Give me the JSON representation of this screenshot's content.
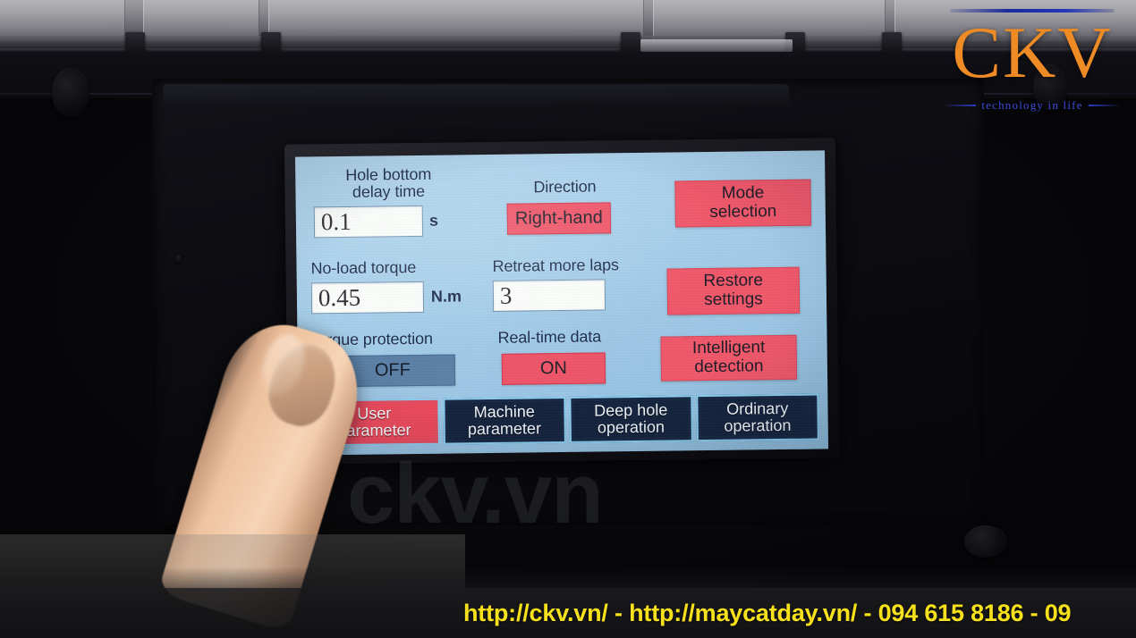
{
  "logo": {
    "name": "CKV",
    "tagline": "technology in life",
    "color": "#ef8b24",
    "tagline_color": "#3b4bd4"
  },
  "watermark": {
    "text": "ckv.vn"
  },
  "banner": {
    "text": "http://ckv.vn/ - http://maycatday.vn/ - 094 615 8186 - 09",
    "color": "#f7e01c"
  },
  "hmi": {
    "screen_bg": "#a6cfea",
    "accent_red": "#f0576a",
    "accent_blue": "#5b7fa6",
    "fields": [
      {
        "id": "hole-bottom-delay-time",
        "label": "Hole bottom\ndelay time",
        "label_line1": "Hole bottom",
        "label_line2": "delay time",
        "value": "0.1",
        "unit": "s",
        "type": "input"
      },
      {
        "id": "direction",
        "label": "Direction",
        "value": "Right-hand",
        "type": "chip",
        "state": "on"
      },
      {
        "id": "no-load-torque",
        "label": "No-load torque",
        "value": "0.45",
        "unit": "N.m",
        "type": "input"
      },
      {
        "id": "retreat-more-laps",
        "label": "Retreat more laps",
        "value": "3",
        "unit": "",
        "type": "input"
      },
      {
        "id": "torque-protection",
        "label": "Torque protection",
        "value": "OFF",
        "type": "chip",
        "state": "off"
      },
      {
        "id": "real-time-data",
        "label": "Real-time data",
        "value": "ON",
        "type": "chip",
        "state": "on"
      }
    ],
    "action_buttons": [
      {
        "id": "mode-selection",
        "line1": "Mode",
        "line2": "selection"
      },
      {
        "id": "restore-settings",
        "line1": "Restore",
        "line2": "settings"
      },
      {
        "id": "intelligent-detection",
        "line1": "Intelligent",
        "line2": "detection"
      }
    ],
    "tabs": [
      {
        "id": "user-parameter",
        "line1": "User",
        "line2": "parameter",
        "active": true
      },
      {
        "id": "machine-parameter",
        "line1": "Machine",
        "line2": "parameter",
        "active": false
      },
      {
        "id": "deep-hole-operation",
        "line1": "Deep hole",
        "line2": "operation",
        "active": false
      },
      {
        "id": "ordinary-operation",
        "line1": "Ordinary",
        "line2": "operation",
        "active": false
      }
    ]
  }
}
